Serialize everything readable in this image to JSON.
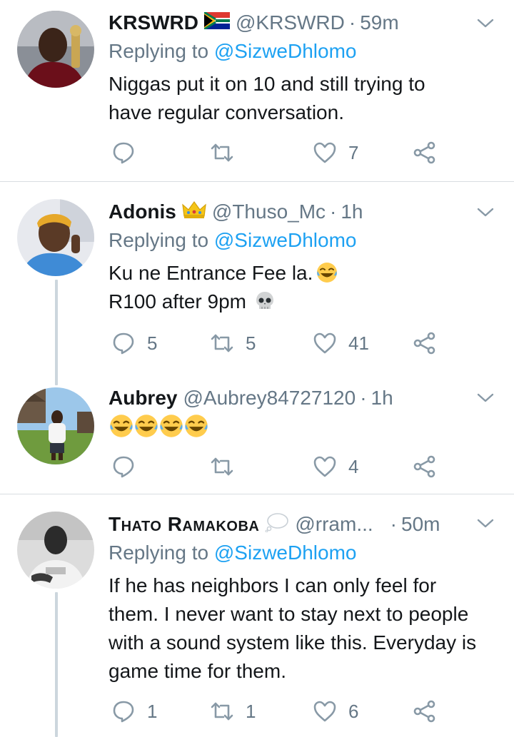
{
  "tweets": [
    {
      "name": "KRSWRD",
      "badge": "south-africa-flag",
      "handle": "@KRSWRD",
      "separator": "·",
      "time": "59m",
      "replying_prefix": "Replying to ",
      "replying_mention": "@SizweDhlomo",
      "text_lines": [
        "Niggas put it on 10 and still trying to",
        "have regular conversation."
      ],
      "replies": "",
      "retweets": "",
      "likes": "7"
    },
    {
      "name": "Adonis",
      "badge": "crown-emoji",
      "handle": "@Thuso_Mc",
      "separator": "·",
      "time": "1h",
      "replying_prefix": "Replying to ",
      "replying_mention": "@SizweDhlomo",
      "text_lines": [
        "Ku ne Entrance Fee la.",
        "R100 after 9pm"
      ],
      "replies": "5",
      "retweets": "5",
      "likes": "41"
    },
    {
      "name": "Aubrey",
      "handle": "@Aubrey84727120",
      "separator": "·",
      "time": "1h",
      "text_emoji": "laughing-crying-emoji-x4",
      "replies": "",
      "retweets": "",
      "likes": "4"
    },
    {
      "name": "Thato Ramakoba",
      "badge": "thought-balloon-emoji",
      "handle": "@rram...",
      "separator": "·",
      "time": "50m",
      "replying_prefix": "Replying to ",
      "replying_mention": "@SizweDhlomo",
      "text_lines": [
        "If he has neighbors I can only feel for",
        "them. I never want to stay next to people",
        "with a sound system like this. Everyday is",
        "game time for them."
      ],
      "replies": "1",
      "retweets": "1",
      "likes": "6"
    }
  ],
  "colors": {
    "text": "#14171a",
    "secondary": "#657786",
    "link": "#1da1f2",
    "divider": "#d8dde1",
    "thread_line": "#ccd6dd"
  }
}
